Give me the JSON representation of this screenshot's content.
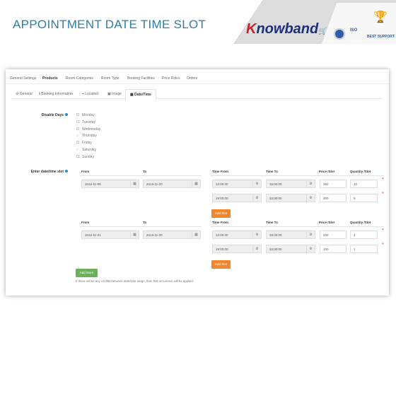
{
  "header": {
    "title": "APPOINTMENT DATE TIME SLOT",
    "logo": "Knowband",
    "badges": [
      "ISO",
      "BEST SUPPORT"
    ]
  },
  "tabs": [
    {
      "label": "General Settings"
    },
    {
      "label": "Products",
      "active": true
    },
    {
      "label": "Room Categories"
    },
    {
      "label": "Room Type"
    },
    {
      "label": "Booking Facilities"
    },
    {
      "label": "Price Rules"
    },
    {
      "label": "Orders"
    }
  ],
  "subtabs": [
    {
      "label": "General",
      "icon": "sliders-icon"
    },
    {
      "label": "Booking Information",
      "icon": "info-icon"
    },
    {
      "label": "Location",
      "icon": "location-icon"
    },
    {
      "label": "Image",
      "icon": "image-icon"
    },
    {
      "label": "Date/Time",
      "icon": "calendar-icon",
      "active": true
    }
  ],
  "disable_days": {
    "label": "Disable Days",
    "days": [
      {
        "name": "Monday",
        "checked": false
      },
      {
        "name": "Tuesday",
        "checked": false
      },
      {
        "name": "Wednesday",
        "checked": false
      },
      {
        "name": "Thursday",
        "checked": true
      },
      {
        "name": "Friday",
        "checked": false
      },
      {
        "name": "Saturday",
        "checked": true
      },
      {
        "name": "Sunday",
        "checked": false
      }
    ]
  },
  "slots": {
    "label": "Enter date/time slot",
    "columns": {
      "from": "From",
      "to": "To",
      "time_from": "Time From",
      "time_to": "Time To",
      "price": "Price /Slot",
      "quantity": "Quantity /Slot"
    },
    "blocks": [
      {
        "from": "2019-11-08",
        "to": "2019-11-20",
        "rows": [
          {
            "time_from": "10:00:00",
            "time_to": "16:00:00",
            "price": "250",
            "quantity": "10"
          },
          {
            "time_from": "19:00:00",
            "time_to": "22:00:00",
            "price": "300",
            "quantity": "5"
          }
        ]
      },
      {
        "from": "2019-11-21",
        "to": "2019-11-30",
        "rows": [
          {
            "time_from": "10:00:00",
            "time_to": "18:00:00",
            "price": "200",
            "quantity": "4"
          },
          {
            "time_from": "19:00:00",
            "time_to": "22:00:00",
            "price": "100",
            "quantity": "1"
          }
        ]
      }
    ],
    "add_slot": "Add Slot",
    "add_more": "Add More",
    "note": "If there will be any conflits between date/time range, then first occurence will be applied."
  },
  "colors": {
    "title": "#2f7da3",
    "orange": "#f2862b",
    "green": "#6cb25b"
  }
}
